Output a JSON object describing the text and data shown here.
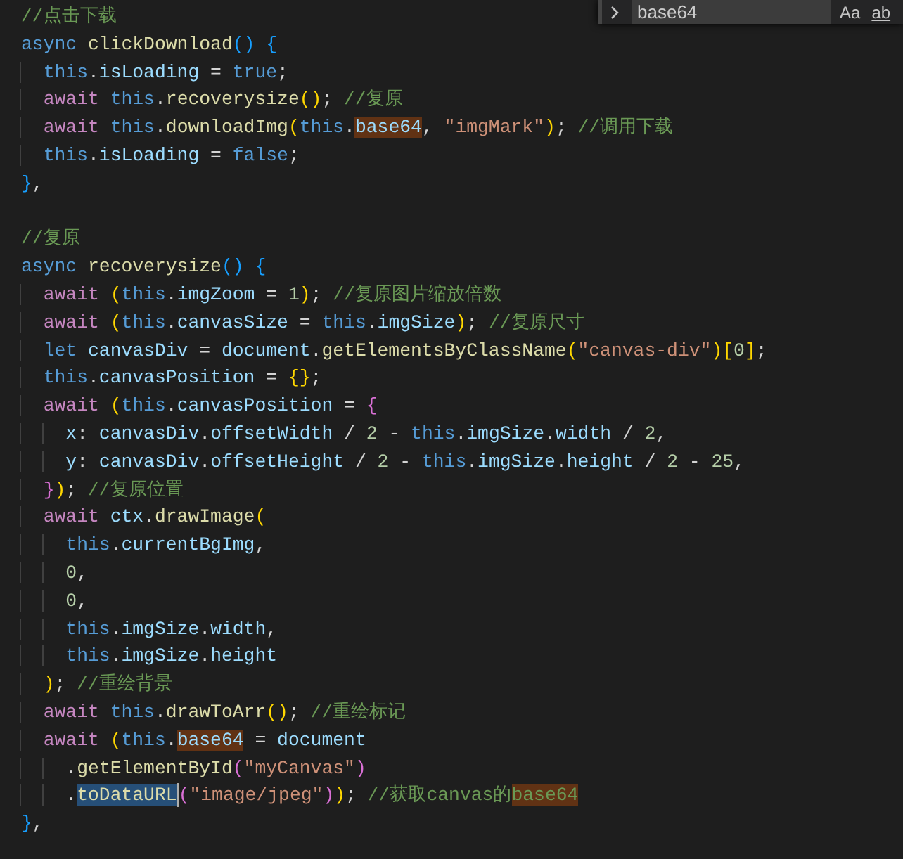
{
  "find_widget": {
    "query": "base64",
    "options": [
      {
        "label": "Aa"
      },
      {
        "label": "ab"
      }
    ]
  },
  "lines": [
    {
      "tokens": [
        {
          "text": "//点击下载",
          "kind": "comment"
        }
      ]
    },
    {
      "tokens": [
        {
          "text": "async",
          "kind": "keyword"
        },
        {
          "text": " clickDownload",
          "kind": "function"
        },
        {
          "text": "()",
          "kind": "bracket3"
        },
        {
          "text": " {",
          "kind": "bracket3"
        }
      ]
    },
    {
      "tokens": [
        {
          "text": "  this",
          "kind": "keyword"
        },
        {
          "text": ".",
          "kind": "punct"
        },
        {
          "text": "isLoading",
          "kind": "variable"
        },
        {
          "text": " = ",
          "kind": "punct"
        },
        {
          "text": "true",
          "kind": "keyword"
        },
        {
          "text": ";",
          "kind": "punct"
        }
      ]
    },
    {
      "tokens": [
        {
          "text": "  await",
          "kind": "control"
        },
        {
          "text": " this",
          "kind": "keyword"
        },
        {
          "text": ".",
          "kind": "punct"
        },
        {
          "text": "recoverysize",
          "kind": "function"
        },
        {
          "text": "()",
          "kind": "bracket1"
        },
        {
          "text": ";",
          "kind": "punct"
        },
        {
          "text": " //复原",
          "kind": "comment"
        }
      ]
    },
    {
      "tokens": [
        {
          "text": "  await",
          "kind": "control"
        },
        {
          "text": " this",
          "kind": "keyword"
        },
        {
          "text": ".",
          "kind": "punct"
        },
        {
          "text": "downloadImg",
          "kind": "function"
        },
        {
          "text": "(",
          "kind": "bracket1"
        },
        {
          "text": "this",
          "kind": "keyword"
        },
        {
          "text": ".",
          "kind": "punct"
        },
        {
          "text": "base64",
          "kind": "variable",
          "match": true
        },
        {
          "text": ", ",
          "kind": "punct"
        },
        {
          "text": "\"imgMark\"",
          "kind": "string"
        },
        {
          "text": ")",
          "kind": "bracket1"
        },
        {
          "text": ";",
          "kind": "punct"
        },
        {
          "text": " //调用下载",
          "kind": "comment"
        }
      ]
    },
    {
      "tokens": [
        {
          "text": "  this",
          "kind": "keyword"
        },
        {
          "text": ".",
          "kind": "punct"
        },
        {
          "text": "isLoading",
          "kind": "variable"
        },
        {
          "text": " = ",
          "kind": "punct"
        },
        {
          "text": "false",
          "kind": "keyword"
        },
        {
          "text": ";",
          "kind": "punct"
        }
      ]
    },
    {
      "tokens": [
        {
          "text": "}",
          "kind": "bracket3"
        },
        {
          "text": ",",
          "kind": "punct"
        }
      ]
    },
    {
      "blank_before": true,
      "tokens": [
        {
          "text": "//复原",
          "kind": "comment"
        }
      ]
    },
    {
      "tokens": [
        {
          "text": "async",
          "kind": "keyword"
        },
        {
          "text": " recoverysize",
          "kind": "function"
        },
        {
          "text": "()",
          "kind": "bracket3"
        },
        {
          "text": " {",
          "kind": "bracket3"
        }
      ]
    },
    {
      "tokens": [
        {
          "text": "  await ",
          "kind": "control"
        },
        {
          "text": "(",
          "kind": "bracket1"
        },
        {
          "text": "this",
          "kind": "keyword"
        },
        {
          "text": ".",
          "kind": "punct"
        },
        {
          "text": "imgZoom",
          "kind": "variable"
        },
        {
          "text": " = ",
          "kind": "punct"
        },
        {
          "text": "1",
          "kind": "number"
        },
        {
          "text": ")",
          "kind": "bracket1"
        },
        {
          "text": ";",
          "kind": "punct"
        },
        {
          "text": " //复原图片缩放倍数",
          "kind": "comment"
        }
      ]
    },
    {
      "tokens": [
        {
          "text": "  await ",
          "kind": "control"
        },
        {
          "text": "(",
          "kind": "bracket1"
        },
        {
          "text": "this",
          "kind": "keyword"
        },
        {
          "text": ".",
          "kind": "punct"
        },
        {
          "text": "canvasSize",
          "kind": "variable"
        },
        {
          "text": " = ",
          "kind": "punct"
        },
        {
          "text": "this",
          "kind": "keyword"
        },
        {
          "text": ".",
          "kind": "punct"
        },
        {
          "text": "imgSize",
          "kind": "variable"
        },
        {
          "text": ")",
          "kind": "bracket1"
        },
        {
          "text": ";",
          "kind": "punct"
        },
        {
          "text": " //复原尺寸",
          "kind": "comment"
        }
      ]
    },
    {
      "tokens": [
        {
          "text": "  let",
          "kind": "keyword"
        },
        {
          "text": " canvasDiv",
          "kind": "variable"
        },
        {
          "text": " = ",
          "kind": "punct"
        },
        {
          "text": "document",
          "kind": "variable"
        },
        {
          "text": ".",
          "kind": "punct"
        },
        {
          "text": "getElementsByClassName",
          "kind": "function"
        },
        {
          "text": "(",
          "kind": "bracket1"
        },
        {
          "text": "\"canvas-div\"",
          "kind": "string"
        },
        {
          "text": ")",
          "kind": "bracket1"
        },
        {
          "text": "[",
          "kind": "bracket1"
        },
        {
          "text": "0",
          "kind": "number"
        },
        {
          "text": "]",
          "kind": "bracket1"
        },
        {
          "text": ";",
          "kind": "punct"
        }
      ]
    },
    {
      "tokens": [
        {
          "text": "  this",
          "kind": "keyword"
        },
        {
          "text": ".",
          "kind": "punct"
        },
        {
          "text": "canvasPosition",
          "kind": "variable"
        },
        {
          "text": " = ",
          "kind": "punct"
        },
        {
          "text": "{}",
          "kind": "bracket1"
        },
        {
          "text": ";",
          "kind": "punct"
        }
      ]
    },
    {
      "tokens": [
        {
          "text": "  await ",
          "kind": "control"
        },
        {
          "text": "(",
          "kind": "bracket1"
        },
        {
          "text": "this",
          "kind": "keyword"
        },
        {
          "text": ".",
          "kind": "punct"
        },
        {
          "text": "canvasPosition",
          "kind": "variable"
        },
        {
          "text": " = ",
          "kind": "punct"
        },
        {
          "text": "{",
          "kind": "bracket2"
        }
      ]
    },
    {
      "tokens": [
        {
          "text": "    x",
          "kind": "variable"
        },
        {
          "text": ": ",
          "kind": "punct"
        },
        {
          "text": "canvasDiv",
          "kind": "variable"
        },
        {
          "text": ".",
          "kind": "punct"
        },
        {
          "text": "offsetWidth",
          "kind": "variable"
        },
        {
          "text": " / ",
          "kind": "punct"
        },
        {
          "text": "2",
          "kind": "number"
        },
        {
          "text": " - ",
          "kind": "punct"
        },
        {
          "text": "this",
          "kind": "keyword"
        },
        {
          "text": ".",
          "kind": "punct"
        },
        {
          "text": "imgSize",
          "kind": "variable"
        },
        {
          "text": ".",
          "kind": "punct"
        },
        {
          "text": "width",
          "kind": "variable"
        },
        {
          "text": " / ",
          "kind": "punct"
        },
        {
          "text": "2",
          "kind": "number"
        },
        {
          "text": ",",
          "kind": "punct"
        }
      ]
    },
    {
      "tokens": [
        {
          "text": "    y",
          "kind": "variable"
        },
        {
          "text": ": ",
          "kind": "punct"
        },
        {
          "text": "canvasDiv",
          "kind": "variable"
        },
        {
          "text": ".",
          "kind": "punct"
        },
        {
          "text": "offsetHeight",
          "kind": "variable"
        },
        {
          "text": " / ",
          "kind": "punct"
        },
        {
          "text": "2",
          "kind": "number"
        },
        {
          "text": " - ",
          "kind": "punct"
        },
        {
          "text": "this",
          "kind": "keyword"
        },
        {
          "text": ".",
          "kind": "punct"
        },
        {
          "text": "imgSize",
          "kind": "variable"
        },
        {
          "text": ".",
          "kind": "punct"
        },
        {
          "text": "height",
          "kind": "variable"
        },
        {
          "text": " / ",
          "kind": "punct"
        },
        {
          "text": "2",
          "kind": "number"
        },
        {
          "text": " - ",
          "kind": "punct"
        },
        {
          "text": "25",
          "kind": "number"
        },
        {
          "text": ",",
          "kind": "punct"
        }
      ]
    },
    {
      "tokens": [
        {
          "text": "  }",
          "kind": "bracket2"
        },
        {
          "text": ")",
          "kind": "bracket1"
        },
        {
          "text": ";",
          "kind": "punct"
        },
        {
          "text": " //复原位置",
          "kind": "comment"
        }
      ]
    },
    {
      "tokens": [
        {
          "text": "  await",
          "kind": "control"
        },
        {
          "text": " ctx",
          "kind": "variable"
        },
        {
          "text": ".",
          "kind": "punct"
        },
        {
          "text": "drawImage",
          "kind": "function"
        },
        {
          "text": "(",
          "kind": "bracket1"
        }
      ]
    },
    {
      "tokens": [
        {
          "text": "    this",
          "kind": "keyword"
        },
        {
          "text": ".",
          "kind": "punct"
        },
        {
          "text": "currentBgImg",
          "kind": "variable"
        },
        {
          "text": ",",
          "kind": "punct"
        }
      ]
    },
    {
      "tokens": [
        {
          "text": "    0",
          "kind": "number"
        },
        {
          "text": ",",
          "kind": "punct"
        }
      ]
    },
    {
      "tokens": [
        {
          "text": "    0",
          "kind": "number"
        },
        {
          "text": ",",
          "kind": "punct"
        }
      ]
    },
    {
      "tokens": [
        {
          "text": "    this",
          "kind": "keyword"
        },
        {
          "text": ".",
          "kind": "punct"
        },
        {
          "text": "imgSize",
          "kind": "variable"
        },
        {
          "text": ".",
          "kind": "punct"
        },
        {
          "text": "width",
          "kind": "variable"
        },
        {
          "text": ",",
          "kind": "punct"
        }
      ]
    },
    {
      "tokens": [
        {
          "text": "    this",
          "kind": "keyword"
        },
        {
          "text": ".",
          "kind": "punct"
        },
        {
          "text": "imgSize",
          "kind": "variable"
        },
        {
          "text": ".",
          "kind": "punct"
        },
        {
          "text": "height",
          "kind": "variable"
        }
      ]
    },
    {
      "tokens": [
        {
          "text": "  )",
          "kind": "bracket1"
        },
        {
          "text": ";",
          "kind": "punct"
        },
        {
          "text": " //重绘背景",
          "kind": "comment"
        }
      ]
    },
    {
      "tokens": [
        {
          "text": "  await",
          "kind": "control"
        },
        {
          "text": " this",
          "kind": "keyword"
        },
        {
          "text": ".",
          "kind": "punct"
        },
        {
          "text": "drawToArr",
          "kind": "function"
        },
        {
          "text": "()",
          "kind": "bracket1"
        },
        {
          "text": ";",
          "kind": "punct"
        },
        {
          "text": " //重绘标记",
          "kind": "comment"
        }
      ]
    },
    {
      "tokens": [
        {
          "text": "  await ",
          "kind": "control"
        },
        {
          "text": "(",
          "kind": "bracket1"
        },
        {
          "text": "this",
          "kind": "keyword"
        },
        {
          "text": ".",
          "kind": "punct"
        },
        {
          "text": "base64",
          "kind": "variable",
          "match": true
        },
        {
          "text": " = ",
          "kind": "punct"
        },
        {
          "text": "document",
          "kind": "variable"
        }
      ]
    },
    {
      "tokens": [
        {
          "text": "    .",
          "kind": "punct"
        },
        {
          "text": "getElementById",
          "kind": "function"
        },
        {
          "text": "(",
          "kind": "bracket2"
        },
        {
          "text": "\"myCanvas\"",
          "kind": "string"
        },
        {
          "text": ")",
          "kind": "bracket2"
        }
      ]
    },
    {
      "tokens": [
        {
          "text": "    .",
          "kind": "punct"
        },
        {
          "text": "toDataURL",
          "kind": "function",
          "selected": true
        },
        {
          "text": "(",
          "kind": "bracket2"
        },
        {
          "text": "\"image/jpeg\"",
          "kind": "string"
        },
        {
          "text": ")",
          "kind": "bracket2"
        },
        {
          "text": ")",
          "kind": "bracket1"
        },
        {
          "text": ";",
          "kind": "punct"
        },
        {
          "text": " //获取canvas的",
          "kind": "comment"
        },
        {
          "text": "base64",
          "kind": "comment",
          "match": true
        }
      ]
    },
    {
      "tokens": [
        {
          "text": "}",
          "kind": "bracket3"
        },
        {
          "text": ",",
          "kind": "punct"
        }
      ]
    }
  ]
}
